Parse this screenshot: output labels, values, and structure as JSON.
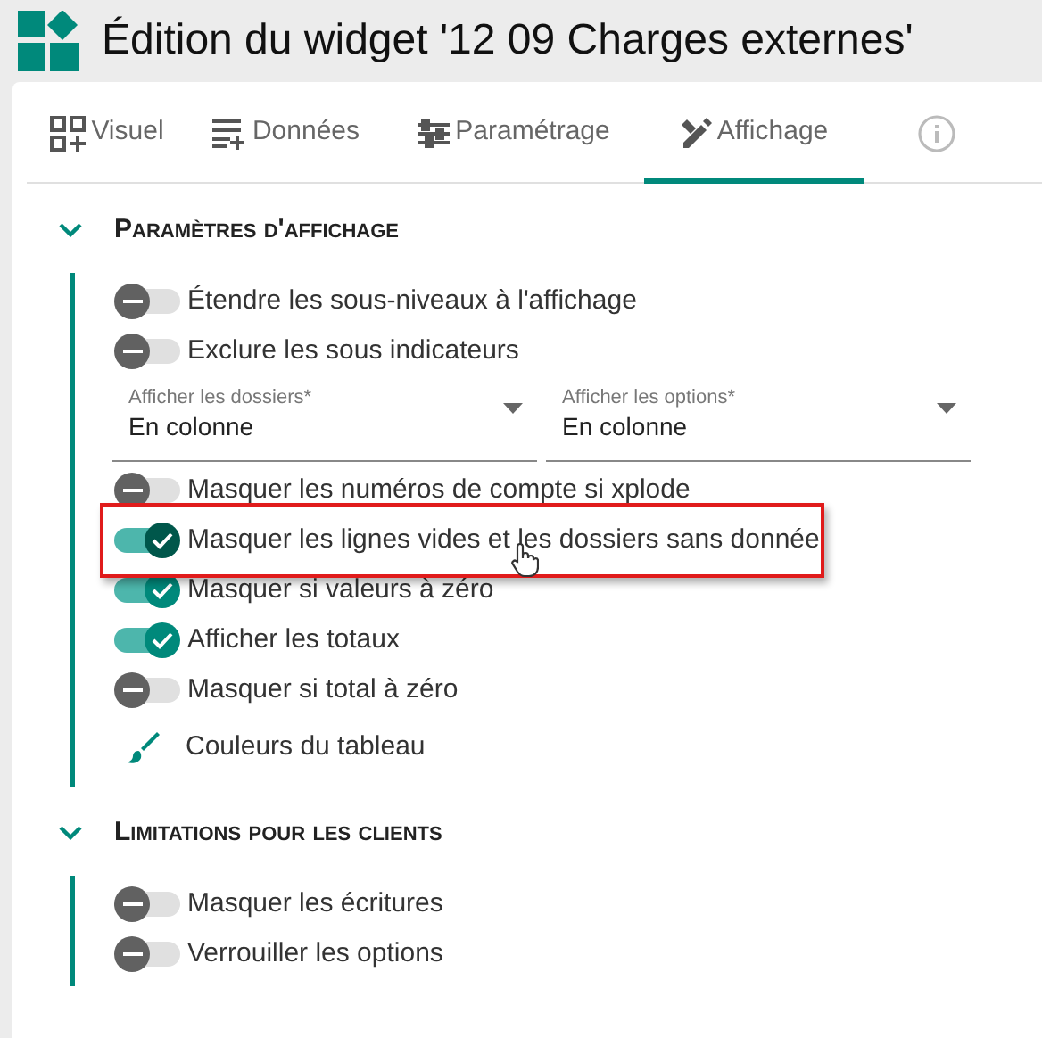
{
  "window": {
    "title": "Édition du widget '12 09 Charges externes'"
  },
  "tabs": [
    {
      "label": "Visuel",
      "kind": "grid",
      "selected": false
    },
    {
      "label": "Données",
      "kind": "list",
      "selected": false
    },
    {
      "label": "Paramétrage",
      "kind": "sliders",
      "selected": false
    },
    {
      "label": "Affichage",
      "kind": "brush",
      "selected": true
    },
    {
      "kind": "info",
      "selected": false
    }
  ],
  "sections": [
    {
      "title": "Paramètres d'affichage",
      "expanded": true,
      "items": [
        {
          "kind": "toggle",
          "label": "Étendre les sous-niveaux à l'affichage",
          "on": false,
          "highlighted": false
        },
        {
          "kind": "toggle",
          "label": "Exclure les sous indicateurs",
          "on": false,
          "highlighted": false
        },
        {
          "kind": "selects",
          "fields": [
            {
              "label": "Afficher les dossiers*",
              "value": "En colonne"
            },
            {
              "label": "Afficher les options*",
              "value": "En colonne"
            }
          ]
        },
        {
          "kind": "toggle",
          "label": "Masquer les numéros de compte si xplode",
          "on": false,
          "highlighted": false
        },
        {
          "kind": "toggle",
          "label": "Masquer les lignes vides et les dossiers sans donnée",
          "on": true,
          "highlighted": true
        },
        {
          "kind": "toggle",
          "label": "Masquer si valeurs à zéro",
          "on": true,
          "highlighted": false
        },
        {
          "kind": "toggle",
          "label": "Afficher les totaux",
          "on": true,
          "highlighted": false
        },
        {
          "kind": "toggle",
          "label": "Masquer si total à zéro",
          "on": false,
          "highlighted": false
        },
        {
          "kind": "link",
          "label": "Couleurs du tableau"
        }
      ]
    },
    {
      "title": "Limitations pour les clients",
      "expanded": true,
      "items": [
        {
          "kind": "toggle",
          "label": "Masquer les écritures",
          "on": false,
          "highlighted": false
        },
        {
          "kind": "toggle",
          "label": "Verrouiller les options",
          "on": false,
          "highlighted": false
        }
      ]
    }
  ]
}
